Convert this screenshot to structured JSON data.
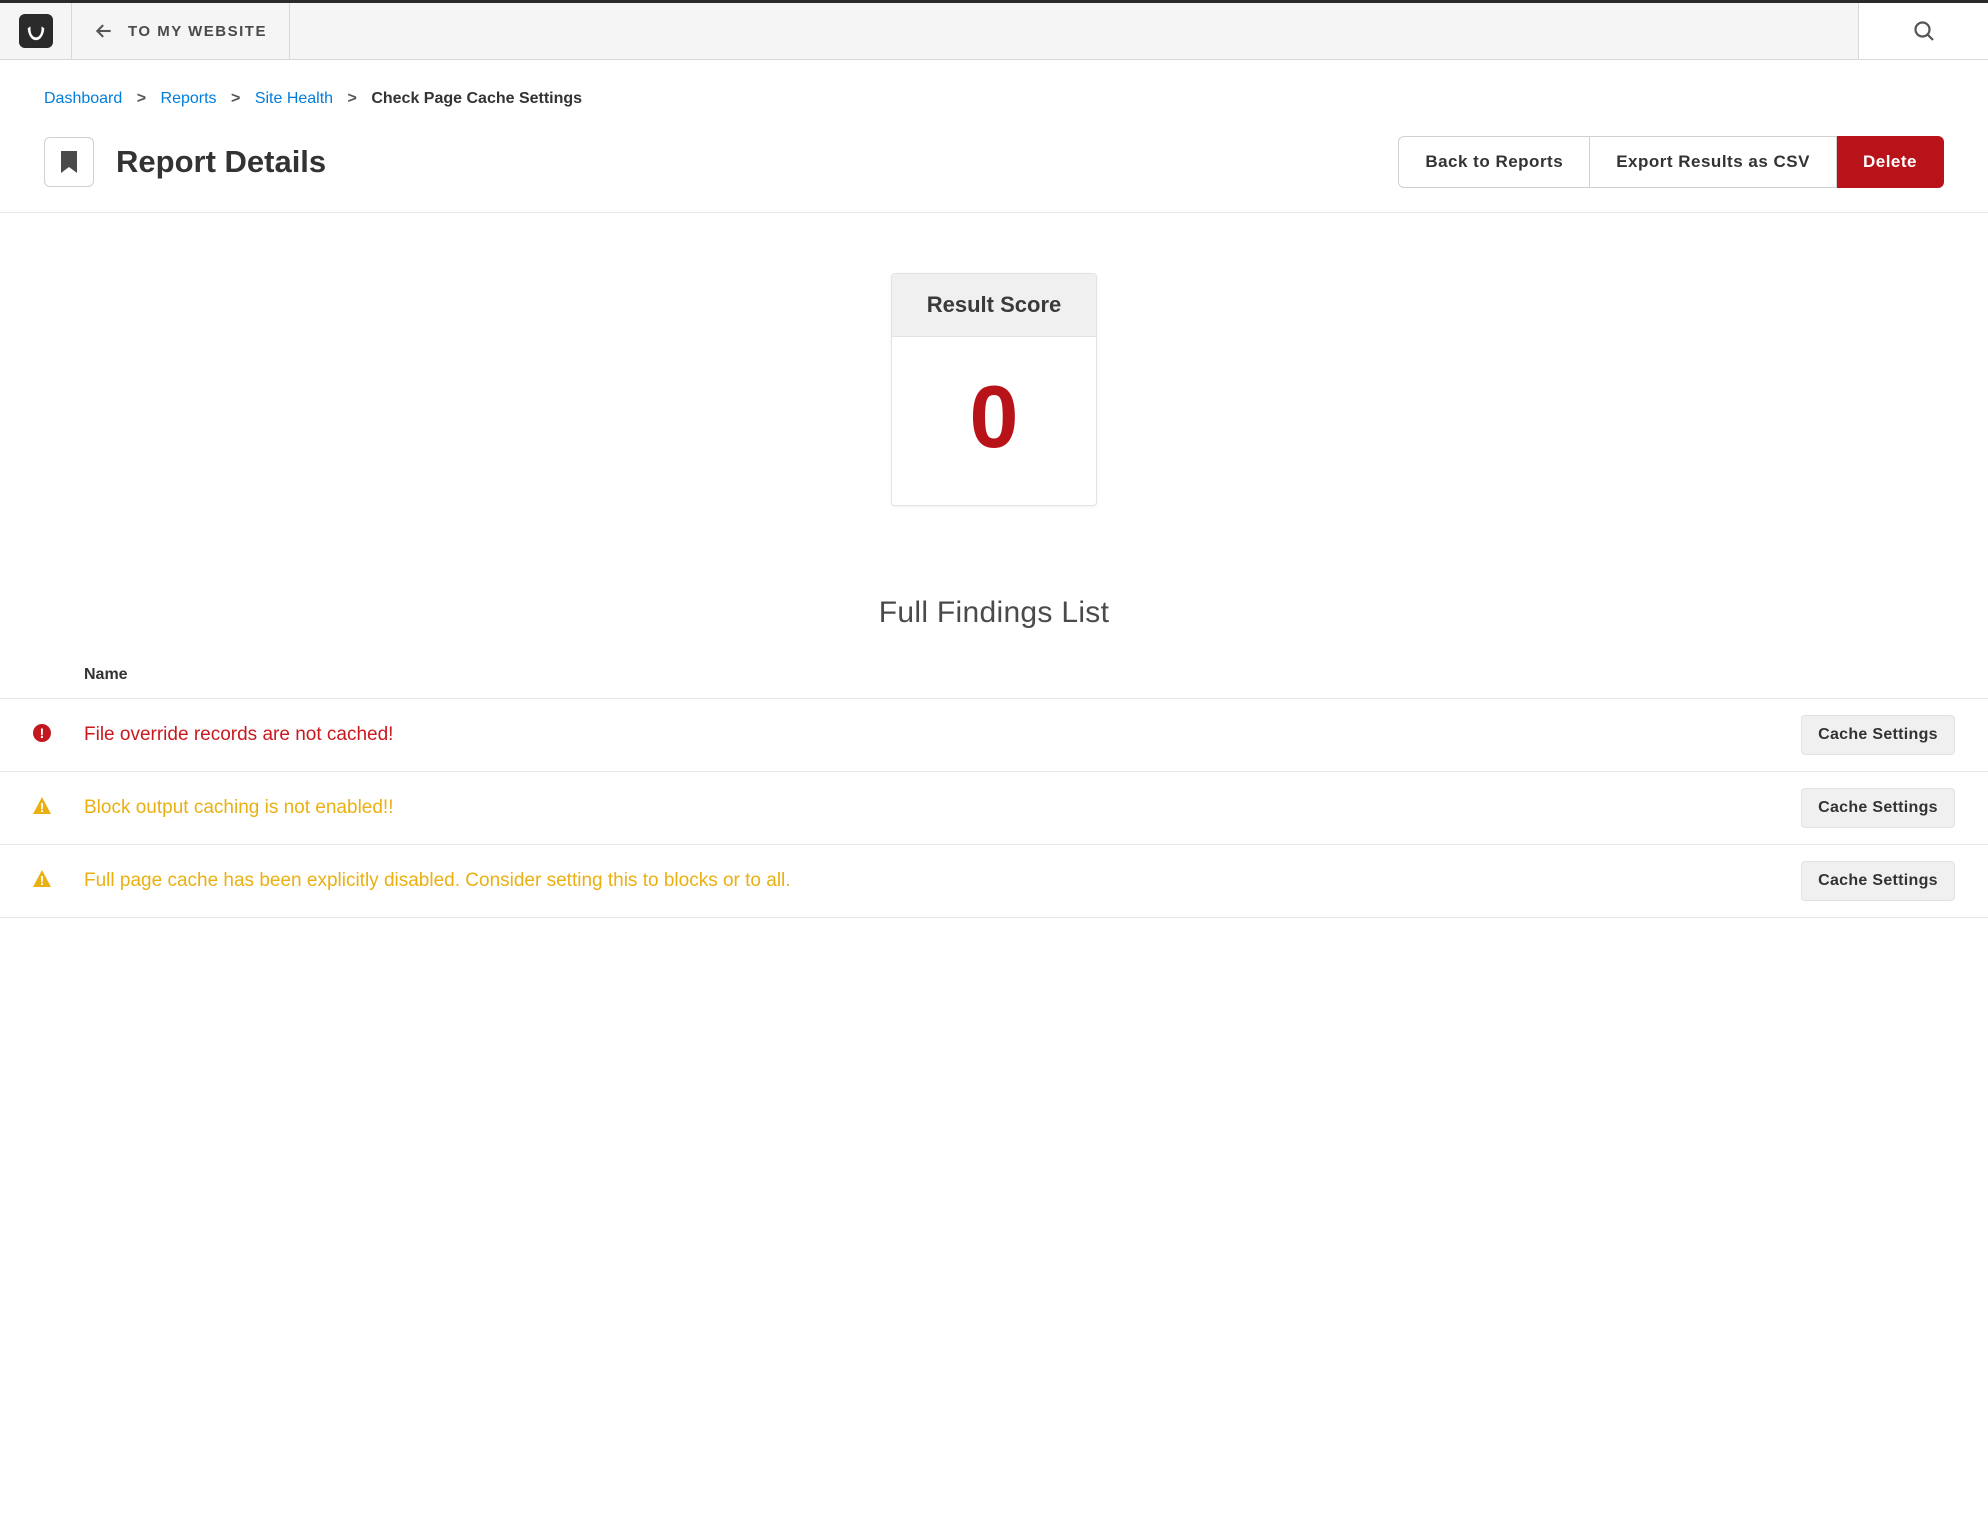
{
  "topbar": {
    "back_label": "TO MY WEBSITE"
  },
  "breadcrumbs": {
    "items": [
      {
        "label": "Dashboard",
        "link": true
      },
      {
        "label": "Reports",
        "link": true
      },
      {
        "label": "Site Health",
        "link": true
      },
      {
        "label": "Check Page Cache Settings",
        "link": false
      }
    ]
  },
  "page": {
    "title": "Report Details",
    "actions": {
      "back": "Back to Reports",
      "export": "Export Results as CSV",
      "delete": "Delete"
    }
  },
  "score": {
    "heading": "Result Score",
    "value": "0"
  },
  "findings": {
    "heading": "Full Findings List",
    "col_name": "Name",
    "rows": [
      {
        "severity": "error",
        "text": "File override records are not cached!",
        "action": "Cache Settings"
      },
      {
        "severity": "warning",
        "text": "Block output caching is not enabled!!",
        "action": "Cache Settings"
      },
      {
        "severity": "warning",
        "text": "Full page cache has been explicitly disabled. Consider setting this to blocks or to all.",
        "action": "Cache Settings"
      }
    ]
  },
  "colors": {
    "danger": "#b9131a",
    "warning": "#eab011",
    "link": "#017ddd"
  }
}
